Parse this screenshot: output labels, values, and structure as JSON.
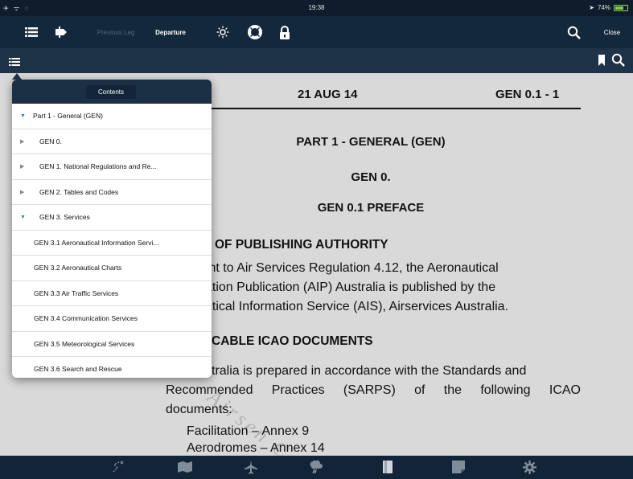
{
  "status_bar": {
    "left_icons": "✈ ᯤ ◌",
    "time": "19:38",
    "battery_text": "74%"
  },
  "toolbar": {
    "prev_leg": "Previous Leg",
    "departure": "Departure",
    "close": "Close"
  },
  "contents": {
    "title": "Contents",
    "items": [
      {
        "label": "Part 1 - General (GEN)",
        "state": "open"
      },
      {
        "label": "GEN 0.",
        "state": "closed"
      },
      {
        "label": "GEN 1. National Regulations and Re...",
        "state": "closed"
      },
      {
        "label": "GEN 2. Tables and Codes",
        "state": "closed"
      },
      {
        "label": "GEN 3. Services",
        "state": "open"
      },
      {
        "label": "GEN 3.1 Aeronautical Information Servi...",
        "state": "leaf"
      },
      {
        "label": "GEN 3.2 Aeronautical Charts",
        "state": "leaf"
      },
      {
        "label": "GEN 3.3 Air Traffic Services",
        "state": "leaf"
      },
      {
        "label": "GEN 3.4 Communication Services",
        "state": "leaf"
      },
      {
        "label": "GEN 3.5 Meteorological Services",
        "state": "leaf"
      },
      {
        "label": "GEN 3.6 Search and Rescue",
        "state": "leaf"
      }
    ]
  },
  "document": {
    "date": "21 AUG 14",
    "page": "GEN 0.1 - 1",
    "part_title": "PART 1 - GENERAL (GEN)",
    "gen0": "GEN 0.",
    "preface": "GEN 0.1  PREFACE",
    "section1": "OF PUBLISHING AUTHORITY",
    "p1_line1": "ınt to Air Services Regulation 4.12, the Aeronautical",
    "p1_line2": "ation Publication (AIP) Australia is published by the",
    "p1_line3": "utical Information Service (AIS), Airservices Australia.",
    "section2": "CABLE ICAO DOCUMENTS",
    "p2_line1": "stralia is prepared in accordance with the Standards and",
    "p2_line2": "Recommended Practices (SARPS) of the following ICAO",
    "p2_line3": "documents:",
    "list1": "Facilitation – Annex 9",
    "list2": "Aerodromes – Annex 14",
    "watermark": "Airsen Co"
  },
  "colors": {
    "accent": "#2a84d6",
    "toolbar": "#14283d",
    "battery": "#7cd43c"
  }
}
